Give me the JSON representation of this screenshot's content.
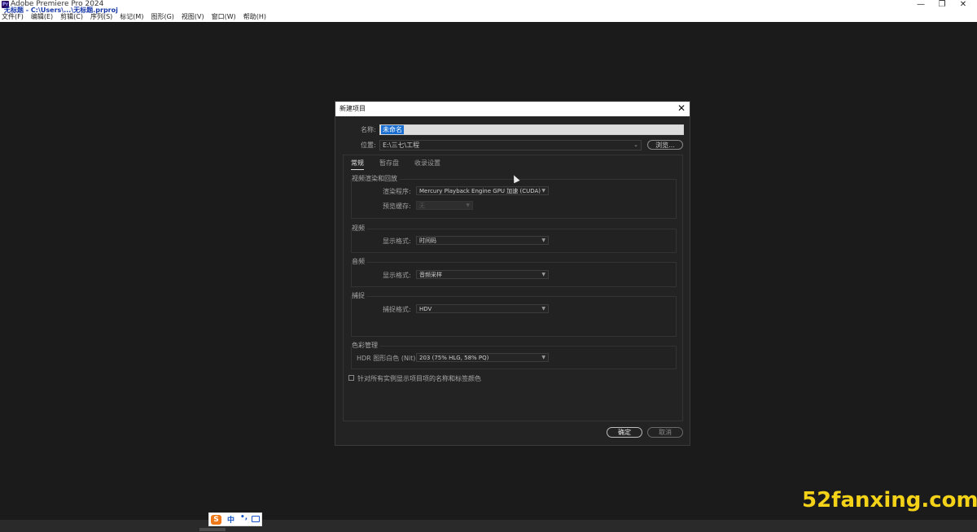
{
  "app": {
    "icon_text": "Pr",
    "title": "Adobe Premiere Pro 2024",
    "project_path": "无标题 - C:\\Users\\...\\无标题.prproj"
  },
  "menu": [
    "文件(F)",
    "编辑(E)",
    "剪辑(C)",
    "序列(S)",
    "标记(M)",
    "图形(G)",
    "视图(V)",
    "窗口(W)",
    "帮助(H)"
  ],
  "window_controls": {
    "minimize": "—",
    "restore": "❐",
    "close": "✕"
  },
  "dialog": {
    "title": "新建项目",
    "close": "✕",
    "name_label": "名称:",
    "name_value": "未命名",
    "location_label": "位置:",
    "location_value": "E:\\三七\\工程",
    "browse_label": "浏览...",
    "tabs": [
      "常规",
      "暂存盘",
      "收录设置"
    ],
    "groups": {
      "render": {
        "title": "视频渲染和回放",
        "renderer_label": "渲染程序:",
        "renderer_value": "Mercury Playback Engine GPU 加速 (CUDA)",
        "preview_cache_label": "预览缓存:",
        "preview_cache_value": "无"
      },
      "video": {
        "title": "视频",
        "display_label": "显示格式:",
        "display_value": "时间码"
      },
      "audio": {
        "title": "音频",
        "display_label": "显示格式:",
        "display_value": "音频采样"
      },
      "capture": {
        "title": "捕捉",
        "format_label": "捕捉格式:",
        "format_value": "HDV"
      },
      "color": {
        "title": "色彩管理",
        "hdr_label": "HDR 图形白色 (Nit):",
        "hdr_value": "203 (75% HLG, 58% PQ)"
      }
    },
    "checkbox_label": "针对所有实例显示项目项的名称和标签颜色",
    "ok_label": "确定",
    "cancel_label": "取消"
  },
  "ime": {
    "logo": "S",
    "lang": "中",
    "punct": "•,",
    "keyboard_icon": "keyboard-icon"
  },
  "watermark": "52fanxing.com",
  "colors": {
    "accent_selection": "#1a6fd0",
    "watermark": "#f4d218",
    "ime_logo": "#f07a1a"
  }
}
